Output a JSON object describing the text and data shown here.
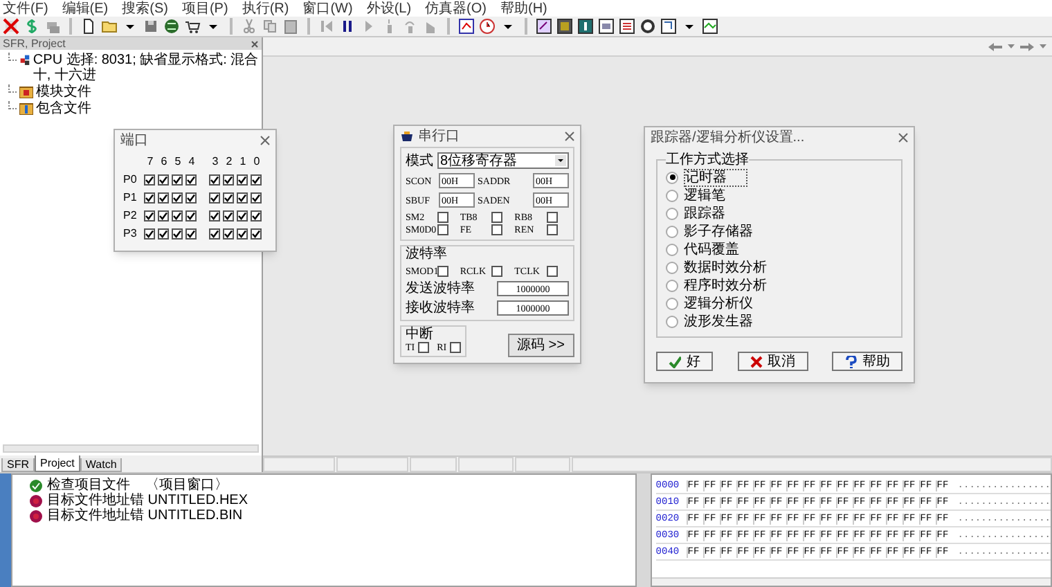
{
  "menu": [
    "文件(F)",
    "编辑(E)",
    "搜索(S)",
    "项目(P)",
    "执行(R)",
    "窗口(W)",
    "外设(L)",
    "仿真器(O)",
    "帮助(H)"
  ],
  "project_panel": {
    "title": "SFR, Project",
    "tree": [
      {
        "kind": "cpu",
        "label": "CPU 选择: 8031;  缺省显示格式: 混合十, 十六进"
      },
      {
        "kind": "module",
        "label": "模块文件"
      },
      {
        "kind": "include",
        "label": "包含文件"
      }
    ],
    "tabs": [
      {
        "label": "SFR",
        "selected": false
      },
      {
        "label": "Project",
        "selected": true
      },
      {
        "label": "Watch",
        "selected": false
      }
    ]
  },
  "ports_dialog": {
    "title": "端口",
    "bit_labels": [
      "7",
      "6",
      "5",
      "4",
      "3",
      "2",
      "1",
      "0"
    ],
    "ports": [
      {
        "name": "P0",
        "bits": [
          true,
          true,
          true,
          true,
          true,
          true,
          true,
          true
        ]
      },
      {
        "name": "P1",
        "bits": [
          true,
          true,
          true,
          true,
          true,
          true,
          true,
          true
        ]
      },
      {
        "name": "P2",
        "bits": [
          true,
          true,
          true,
          true,
          true,
          true,
          true,
          true
        ]
      },
      {
        "name": "P3",
        "bits": [
          true,
          true,
          true,
          true,
          true,
          true,
          true,
          true
        ]
      }
    ]
  },
  "serial_dialog": {
    "title": "串行口",
    "mode_label": "模式",
    "mode_value": "8位移寄存器",
    "registers": [
      {
        "label": "SCON",
        "value": "00H"
      },
      {
        "label": "SADDR",
        "value": "00H"
      },
      {
        "label": "SBUF",
        "value": "00H"
      },
      {
        "label": "SADEN",
        "value": "00H"
      }
    ],
    "flags": [
      {
        "label": "SM2",
        "checked": false
      },
      {
        "label": "TB8",
        "checked": false
      },
      {
        "label": "RB8",
        "checked": false
      },
      {
        "label": "SM0D0",
        "checked": false
      },
      {
        "label": "FE",
        "checked": false
      },
      {
        "label": "REN",
        "checked": false
      }
    ],
    "baud_group": "波特率",
    "baud_flags": [
      {
        "label": "SMOD1",
        "checked": false
      },
      {
        "label": "RCLK",
        "checked": false
      },
      {
        "label": "TCLK",
        "checked": false
      }
    ],
    "rates": [
      {
        "label": "发送波特率",
        "value": "1000000"
      },
      {
        "label": "接收波特率",
        "value": "1000000"
      }
    ],
    "interrupt_group": "中断",
    "interrupt_flags": [
      {
        "label": "TI",
        "checked": false
      },
      {
        "label": "RI",
        "checked": false
      }
    ],
    "source_button": "源码 >>"
  },
  "tracker_dialog": {
    "title": "跟踪器/逻辑分析仪设置...",
    "group": "工作方式选择",
    "options": [
      {
        "label": "记时器",
        "selected": true
      },
      {
        "label": "逻辑笔",
        "selected": false
      },
      {
        "label": "跟踪器",
        "selected": false
      },
      {
        "label": "影子存储器",
        "selected": false
      },
      {
        "label": "代码覆盖",
        "selected": false
      },
      {
        "label": "数据时效分析",
        "selected": false
      },
      {
        "label": "程序时效分析",
        "selected": false
      },
      {
        "label": "逻辑分析仪",
        "selected": false
      },
      {
        "label": "波形发生器",
        "selected": false
      }
    ],
    "buttons": [
      {
        "kind": "ok",
        "label": "好"
      },
      {
        "kind": "cancel",
        "label": "取消"
      },
      {
        "kind": "help",
        "label": "帮助"
      }
    ]
  },
  "output": [
    {
      "kind": "ok",
      "label": "检查项目文件",
      "note": "〈项目窗口〉"
    },
    {
      "kind": "error",
      "label": "目标文件地址错 UNTITLED.HEX"
    },
    {
      "kind": "error",
      "label": "目标文件地址错 UNTITLED.BIN"
    }
  ],
  "memory": [
    {
      "address": "0000",
      "bytes": [
        "FF",
        "FF",
        "FF",
        "FF",
        "FF",
        "FF",
        "FF",
        "FF",
        "FF",
        "FF",
        "FF",
        "FF",
        "FF",
        "FF",
        "FF",
        "FF"
      ],
      "ascii": "................"
    },
    {
      "address": "0010",
      "bytes": [
        "FF",
        "FF",
        "FF",
        "FF",
        "FF",
        "FF",
        "FF",
        "FF",
        "FF",
        "FF",
        "FF",
        "FF",
        "FF",
        "FF",
        "FF",
        "FF"
      ],
      "ascii": "................"
    },
    {
      "address": "0020",
      "bytes": [
        "FF",
        "FF",
        "FF",
        "FF",
        "FF",
        "FF",
        "FF",
        "FF",
        "FF",
        "FF",
        "FF",
        "FF",
        "FF",
        "FF",
        "FF",
        "FF"
      ],
      "ascii": "................"
    },
    {
      "address": "0030",
      "bytes": [
        "FF",
        "FF",
        "FF",
        "FF",
        "FF",
        "FF",
        "FF",
        "FF",
        "FF",
        "FF",
        "FF",
        "FF",
        "FF",
        "FF",
        "FF",
        "FF"
      ],
      "ascii": "................"
    },
    {
      "address": "0040",
      "bytes": [
        "FF",
        "FF",
        "FF",
        "FF",
        "FF",
        "FF",
        "FF",
        "FF",
        "FF",
        "FF",
        "FF",
        "FF",
        "FF",
        "FF",
        "FF",
        "FF"
      ],
      "ascii": "................"
    }
  ]
}
